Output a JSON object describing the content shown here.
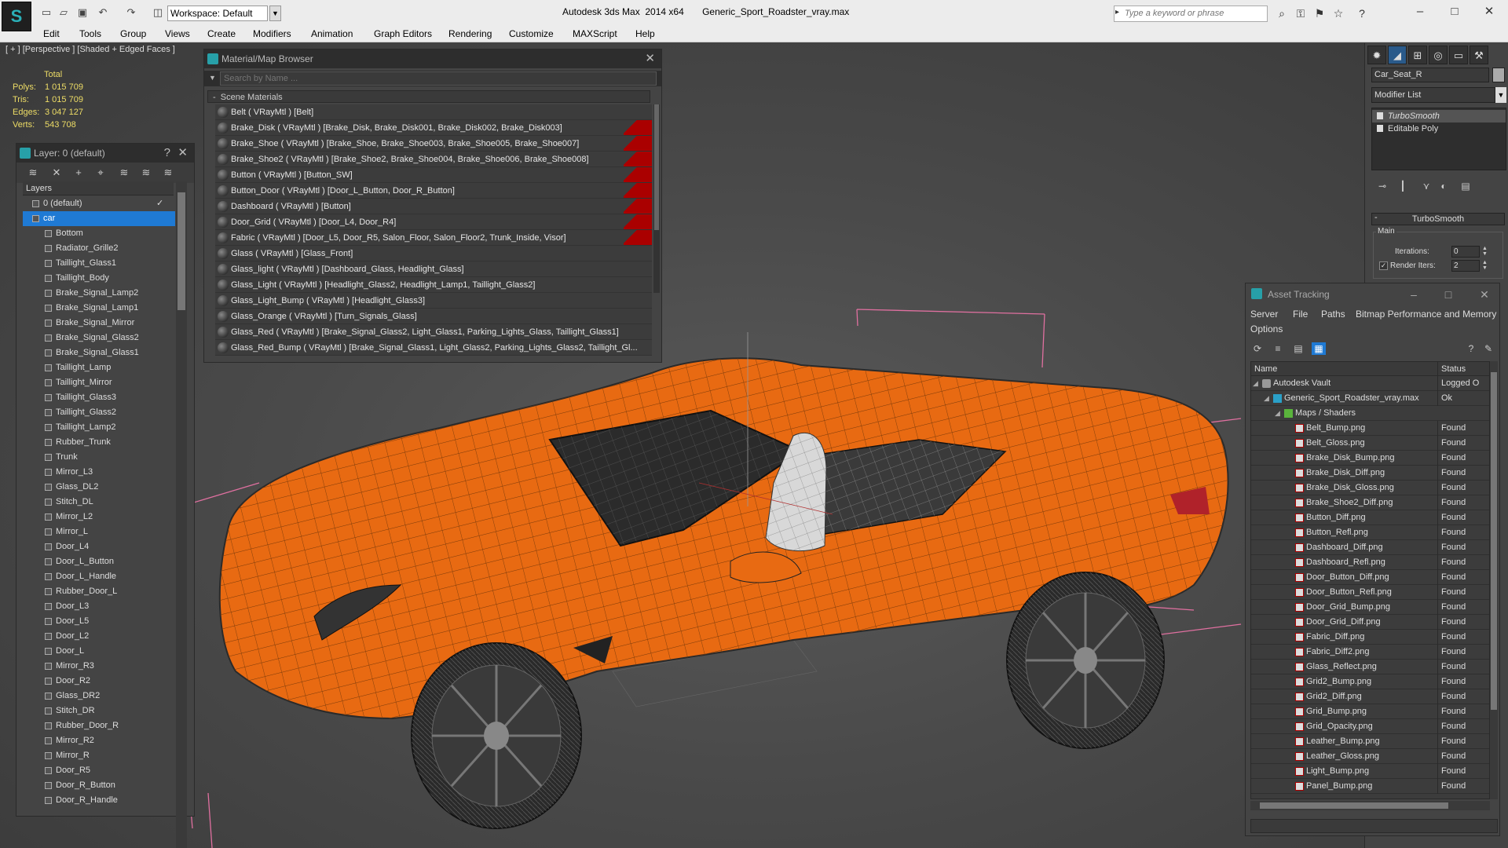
{
  "app": {
    "window_title": "Autodesk 3ds Max  2014 x64       Generic_Sport_Roadster_vray.max",
    "workspace": "Workspace: Default",
    "search_placeholder": "Type a keyword or phrase"
  },
  "menu": [
    "Edit",
    "Tools",
    "Group",
    "Views",
    "Create",
    "Modifiers",
    "Animation",
    "Graph Editors",
    "Rendering",
    "Customize",
    "MAXScript",
    "Help"
  ],
  "viewport": {
    "label": "[ + ] [Perspective ] [Shaded + Edged Faces ]",
    "stats_total": "Total",
    "stats": [
      {
        "key": "Polys:",
        "value": "1 015 709"
      },
      {
        "key": "Tris:",
        "value": "1 015 709"
      },
      {
        "key": "Edges:",
        "value": "3 047 127"
      },
      {
        "key": "Verts:",
        "value": "543 708"
      }
    ],
    "car_color": "#e86a12"
  },
  "material_browser": {
    "title": "Material/Map Browser",
    "search_placeholder": "Search by Name ...",
    "group": "Scene Materials",
    "materials": [
      {
        "label": "Belt  ( VRayMtl )  [Belt]",
        "flag": false
      },
      {
        "label": "Brake_Disk  ( VRayMtl )  [Brake_Disk, Brake_Disk001, Brake_Disk002, Brake_Disk003]",
        "flag": true
      },
      {
        "label": "Brake_Shoe  ( VRayMtl )  [Brake_Shoe, Brake_Shoe003, Brake_Shoe005, Brake_Shoe007]",
        "flag": true
      },
      {
        "label": "Brake_Shoe2  ( VRayMtl )  [Brake_Shoe2, Brake_Shoe004, Brake_Shoe006, Brake_Shoe008]",
        "flag": true
      },
      {
        "label": "Button  ( VRayMtl )  [Button_SW]",
        "flag": true
      },
      {
        "label": "Button_Door  ( VRayMtl )  [Door_L_Button, Door_R_Button]",
        "flag": true
      },
      {
        "label": "Dashboard  ( VRayMtl )  [Button]",
        "flag": true
      },
      {
        "label": "Door_Grid  ( VRayMtl )  [Door_L4, Door_R4]",
        "flag": true
      },
      {
        "label": "Fabric  ( VRayMtl )  [Door_L5, Door_R5, Salon_Floor, Salon_Floor2, Trunk_Inside, Visor]",
        "flag": true
      },
      {
        "label": "Glass  ( VRayMtl )  [Glass_Front]",
        "flag": false
      },
      {
        "label": "Glass_light  ( VRayMtl )  [Dashboard_Glass, Headlight_Glass]",
        "flag": false
      },
      {
        "label": "Glass_Light  ( VRayMtl )  [Headlight_Glass2, Headlight_Lamp1, Taillight_Glass2]",
        "flag": false
      },
      {
        "label": "Glass_Light_Bump  ( VRayMtl )  [Headlight_Glass3]",
        "flag": false
      },
      {
        "label": "Glass_Orange  ( VRayMtl )  [Turn_Signals_Glass]",
        "flag": false
      },
      {
        "label": "Glass_Red  ( VRayMtl )  [Brake_Signal_Glass2, Light_Glass1, Parking_Lights_Glass, Taillight_Glass1]",
        "flag": false
      },
      {
        "label": "Glass_Red_Bump  ( VRayMtl )  [Brake_Signal_Glass1, Light_Glass2, Parking_Lights_Glass2, Taillight_Gl...",
        "flag": false
      }
    ]
  },
  "layers": {
    "title": "Layer: 0 (default)",
    "column": "Layers",
    "items": [
      {
        "label": "0 (default)",
        "level": 1,
        "selected": false,
        "check": "✓"
      },
      {
        "label": "car",
        "level": 1,
        "selected": true,
        "check": ""
      },
      {
        "label": "Bottom",
        "level": 2
      },
      {
        "label": "Radiator_Grille2",
        "level": 2
      },
      {
        "label": "Taillight_Glass1",
        "level": 2
      },
      {
        "label": "Taillight_Body",
        "level": 2
      },
      {
        "label": "Brake_Signal_Lamp2",
        "level": 2
      },
      {
        "label": "Brake_Signal_Lamp1",
        "level": 2
      },
      {
        "label": "Brake_Signal_Mirror",
        "level": 2
      },
      {
        "label": "Brake_Signal_Glass2",
        "level": 2
      },
      {
        "label": "Brake_Signal_Glass1",
        "level": 2
      },
      {
        "label": "Taillight_Lamp",
        "level": 2
      },
      {
        "label": "Taillight_Mirror",
        "level": 2
      },
      {
        "label": "Taillight_Glass3",
        "level": 2
      },
      {
        "label": "Taillight_Glass2",
        "level": 2
      },
      {
        "label": "Taillight_Lamp2",
        "level": 2
      },
      {
        "label": "Rubber_Trunk",
        "level": 2
      },
      {
        "label": "Trunk",
        "level": 2
      },
      {
        "label": "Mirror_L3",
        "level": 2
      },
      {
        "label": "Glass_DL2",
        "level": 2
      },
      {
        "label": "Stitch_DL",
        "level": 2
      },
      {
        "label": "Mirror_L2",
        "level": 2
      },
      {
        "label": "Mirror_L",
        "level": 2
      },
      {
        "label": "Door_L4",
        "level": 2
      },
      {
        "label": "Door_L_Button",
        "level": 2
      },
      {
        "label": "Door_L_Handle",
        "level": 2
      },
      {
        "label": "Rubber_Door_L",
        "level": 2
      },
      {
        "label": "Door_L3",
        "level": 2
      },
      {
        "label": "Door_L5",
        "level": 2
      },
      {
        "label": "Door_L2",
        "level": 2
      },
      {
        "label": "Door_L",
        "level": 2
      },
      {
        "label": "Mirror_R3",
        "level": 2
      },
      {
        "label": "Door_R2",
        "level": 2
      },
      {
        "label": "Glass_DR2",
        "level": 2
      },
      {
        "label": "Stitch_DR",
        "level": 2
      },
      {
        "label": "Rubber_Door_R",
        "level": 2
      },
      {
        "label": "Mirror_R2",
        "level": 2
      },
      {
        "label": "Mirror_R",
        "level": 2
      },
      {
        "label": "Door_R5",
        "level": 2
      },
      {
        "label": "Door_R_Button",
        "level": 2
      },
      {
        "label": "Door_R_Handle",
        "level": 2
      }
    ]
  },
  "command_panel": {
    "object_name": "Car_Seat_R",
    "modifier_list": "Modifier List",
    "stack": [
      "TurboSmooth",
      "Editable Poly"
    ],
    "rollout": "TurboSmooth",
    "group": "Main",
    "iterations_label": "Iterations:",
    "iterations_value": "0",
    "render_iters_label": "Render Iters:",
    "render_iters_value": "2",
    "render_iters_checked": true
  },
  "asset_tracking": {
    "title": "Asset Tracking",
    "menu": [
      "Server",
      "File",
      "Paths",
      "Bitmap Performance and Memory",
      "Options"
    ],
    "col_name": "Name",
    "col_status": "Status",
    "rows": [
      {
        "name": "Autodesk Vault",
        "status": "Logged O",
        "level": 0,
        "kind": "vault"
      },
      {
        "name": "Generic_Sport_Roadster_vray.max",
        "status": "Ok",
        "level": 1,
        "kind": "max"
      },
      {
        "name": "Maps / Shaders",
        "status": "",
        "level": 2,
        "kind": "folder"
      },
      {
        "name": "Belt_Bump.png",
        "status": "Found",
        "level": 3,
        "kind": "png"
      },
      {
        "name": "Belt_Gloss.png",
        "status": "Found",
        "level": 3,
        "kind": "png"
      },
      {
        "name": "Brake_Disk_Bump.png",
        "status": "Found",
        "level": 3,
        "kind": "png"
      },
      {
        "name": "Brake_Disk_Diff.png",
        "status": "Found",
        "level": 3,
        "kind": "png"
      },
      {
        "name": "Brake_Disk_Gloss.png",
        "status": "Found",
        "level": 3,
        "kind": "png"
      },
      {
        "name": "Brake_Shoe2_Diff.png",
        "status": "Found",
        "level": 3,
        "kind": "png"
      },
      {
        "name": "Button_Diff.png",
        "status": "Found",
        "level": 3,
        "kind": "png"
      },
      {
        "name": "Button_Refl.png",
        "status": "Found",
        "level": 3,
        "kind": "png"
      },
      {
        "name": "Dashboard_Diff.png",
        "status": "Found",
        "level": 3,
        "kind": "png"
      },
      {
        "name": "Dashboard_Refl.png",
        "status": "Found",
        "level": 3,
        "kind": "png"
      },
      {
        "name": "Door_Button_Diff.png",
        "status": "Found",
        "level": 3,
        "kind": "png"
      },
      {
        "name": "Door_Button_Refl.png",
        "status": "Found",
        "level": 3,
        "kind": "png"
      },
      {
        "name": "Door_Grid_Bump.png",
        "status": "Found",
        "level": 3,
        "kind": "png"
      },
      {
        "name": "Door_Grid_Diff.png",
        "status": "Found",
        "level": 3,
        "kind": "png"
      },
      {
        "name": "Fabric_Diff.png",
        "status": "Found",
        "level": 3,
        "kind": "png"
      },
      {
        "name": "Fabric_Diff2.png",
        "status": "Found",
        "level": 3,
        "kind": "png"
      },
      {
        "name": "Glass_Reflect.png",
        "status": "Found",
        "level": 3,
        "kind": "png"
      },
      {
        "name": "Grid2_Bump.png",
        "status": "Found",
        "level": 3,
        "kind": "png"
      },
      {
        "name": "Grid2_Diff.png",
        "status": "Found",
        "level": 3,
        "kind": "png"
      },
      {
        "name": "Grid_Bump.png",
        "status": "Found",
        "level": 3,
        "kind": "png"
      },
      {
        "name": "Grid_Opacity.png",
        "status": "Found",
        "level": 3,
        "kind": "png"
      },
      {
        "name": "Leather_Bump.png",
        "status": "Found",
        "level": 3,
        "kind": "png"
      },
      {
        "name": "Leather_Gloss.png",
        "status": "Found",
        "level": 3,
        "kind": "png"
      },
      {
        "name": "Light_Bump.png",
        "status": "Found",
        "level": 3,
        "kind": "png"
      },
      {
        "name": "Panel_Bump.png",
        "status": "Found",
        "level": 3,
        "kind": "png"
      }
    ]
  }
}
